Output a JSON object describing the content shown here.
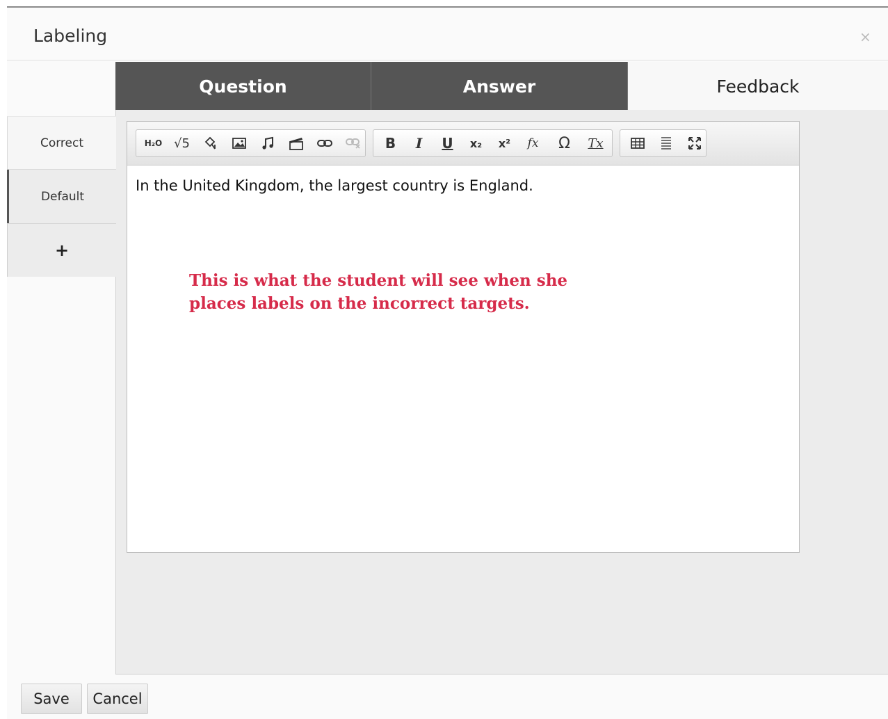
{
  "dialog": {
    "title": "Labeling",
    "close_glyph": "×"
  },
  "tabs": [
    {
      "label": "Question",
      "active": false
    },
    {
      "label": "Answer",
      "active": false
    },
    {
      "label": "Feedback",
      "active": true
    }
  ],
  "sidebar": {
    "items": [
      {
        "label": "Correct"
      },
      {
        "label": "Default",
        "selected": true
      }
    ],
    "add_label": "+"
  },
  "toolbar": {
    "groups": [
      [
        "chemistry-icon",
        "math-root-icon",
        "drawing-icon",
        "image-icon",
        "audio-icon",
        "video-icon",
        "link-icon",
        "unlink-icon"
      ],
      [
        "bold-icon",
        "italic-icon",
        "underline-icon",
        "subscript-icon",
        "superscript-icon",
        "formula-icon",
        "special-char-icon",
        "remove-format-icon"
      ],
      [
        "table-icon",
        "horizontal-rule-icon",
        "maximize-icon"
      ]
    ],
    "chemistry_glyph": "H₂O",
    "sqrt_glyph": "√5",
    "bold_glyph": "B",
    "italic_glyph": "I",
    "underline_glyph": "U",
    "subscript_glyph": "x₂",
    "superscript_glyph": "x²",
    "formula_glyph": "fx",
    "omega_glyph": "Ω",
    "remove_format_glyph": "Tx"
  },
  "editor": {
    "content": "In the United Kingdom, the largest country is England."
  },
  "annotation": {
    "text": "This is what the student will see when she places labels on the incorrect targets.",
    "color": "#d62b4a"
  },
  "footer": {
    "save_label": "Save",
    "cancel_label": "Cancel"
  }
}
